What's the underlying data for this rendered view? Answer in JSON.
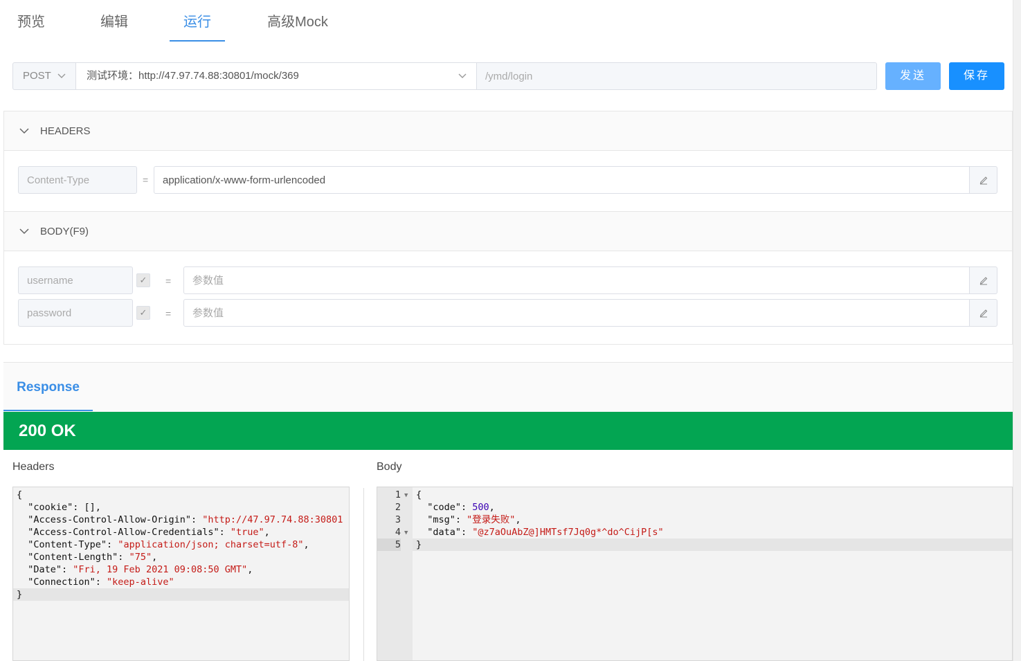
{
  "tabs": [
    {
      "label": "预览"
    },
    {
      "label": "编辑"
    },
    {
      "label": "运行"
    },
    {
      "label": "高级Mock"
    }
  ],
  "request": {
    "method": "POST",
    "environment": "测试环境：http://47.97.74.88:30801/mock/369",
    "path": "/ymd/login",
    "send_label": "发送",
    "save_label": "保存"
  },
  "headers_section": {
    "title": "HEADERS",
    "key": "Content-Type",
    "eq": "=",
    "value": "application/x-www-form-urlencoded"
  },
  "body_section": {
    "title": "BODY(F9)",
    "rows": [
      {
        "key": "username",
        "placeholder": "参数值",
        "eq": "="
      },
      {
        "key": "password",
        "placeholder": "参数值",
        "eq": "="
      }
    ]
  },
  "response": {
    "tab_label": "Response",
    "status": "200 OK",
    "status_color": "#03a552",
    "headers_label": "Headers",
    "body_label": "Body",
    "headers_json": [
      "{",
      "  \"cookie\": [],",
      "  \"Access-Control-Allow-Origin\": \"http://47.97.74.88:30801",
      "  \"Access-Control-Allow-Credentials\": \"true\",",
      "  \"Content-Type\": \"application/json; charset=utf-8\",",
      "  \"Content-Length\": \"75\",",
      "  \"Date\": \"Fri, 19 Feb 2021 09:08:50 GMT\",",
      "  \"Connection\": \"keep-alive\"",
      "}"
    ],
    "body_json": [
      "{",
      "  \"code\": 500,",
      "  \"msg\": \"登录失败\",",
      "  \"data\": \"@z7aOuAbZ@]HMTsf7Jq0g*^do^CijP[s\"",
      "}"
    ],
    "body_line_numbers": [
      "1",
      "2",
      "3",
      "4",
      "5"
    ]
  },
  "icons": {
    "dropdown": "chevron-down-icon",
    "collapse": "chevron-down-icon",
    "edit": "pencil-icon",
    "check": "check-icon"
  },
  "colors": {
    "accent": "#3a8ee6",
    "send_button": "#66b1ff",
    "save_button": "#1890ff"
  }
}
